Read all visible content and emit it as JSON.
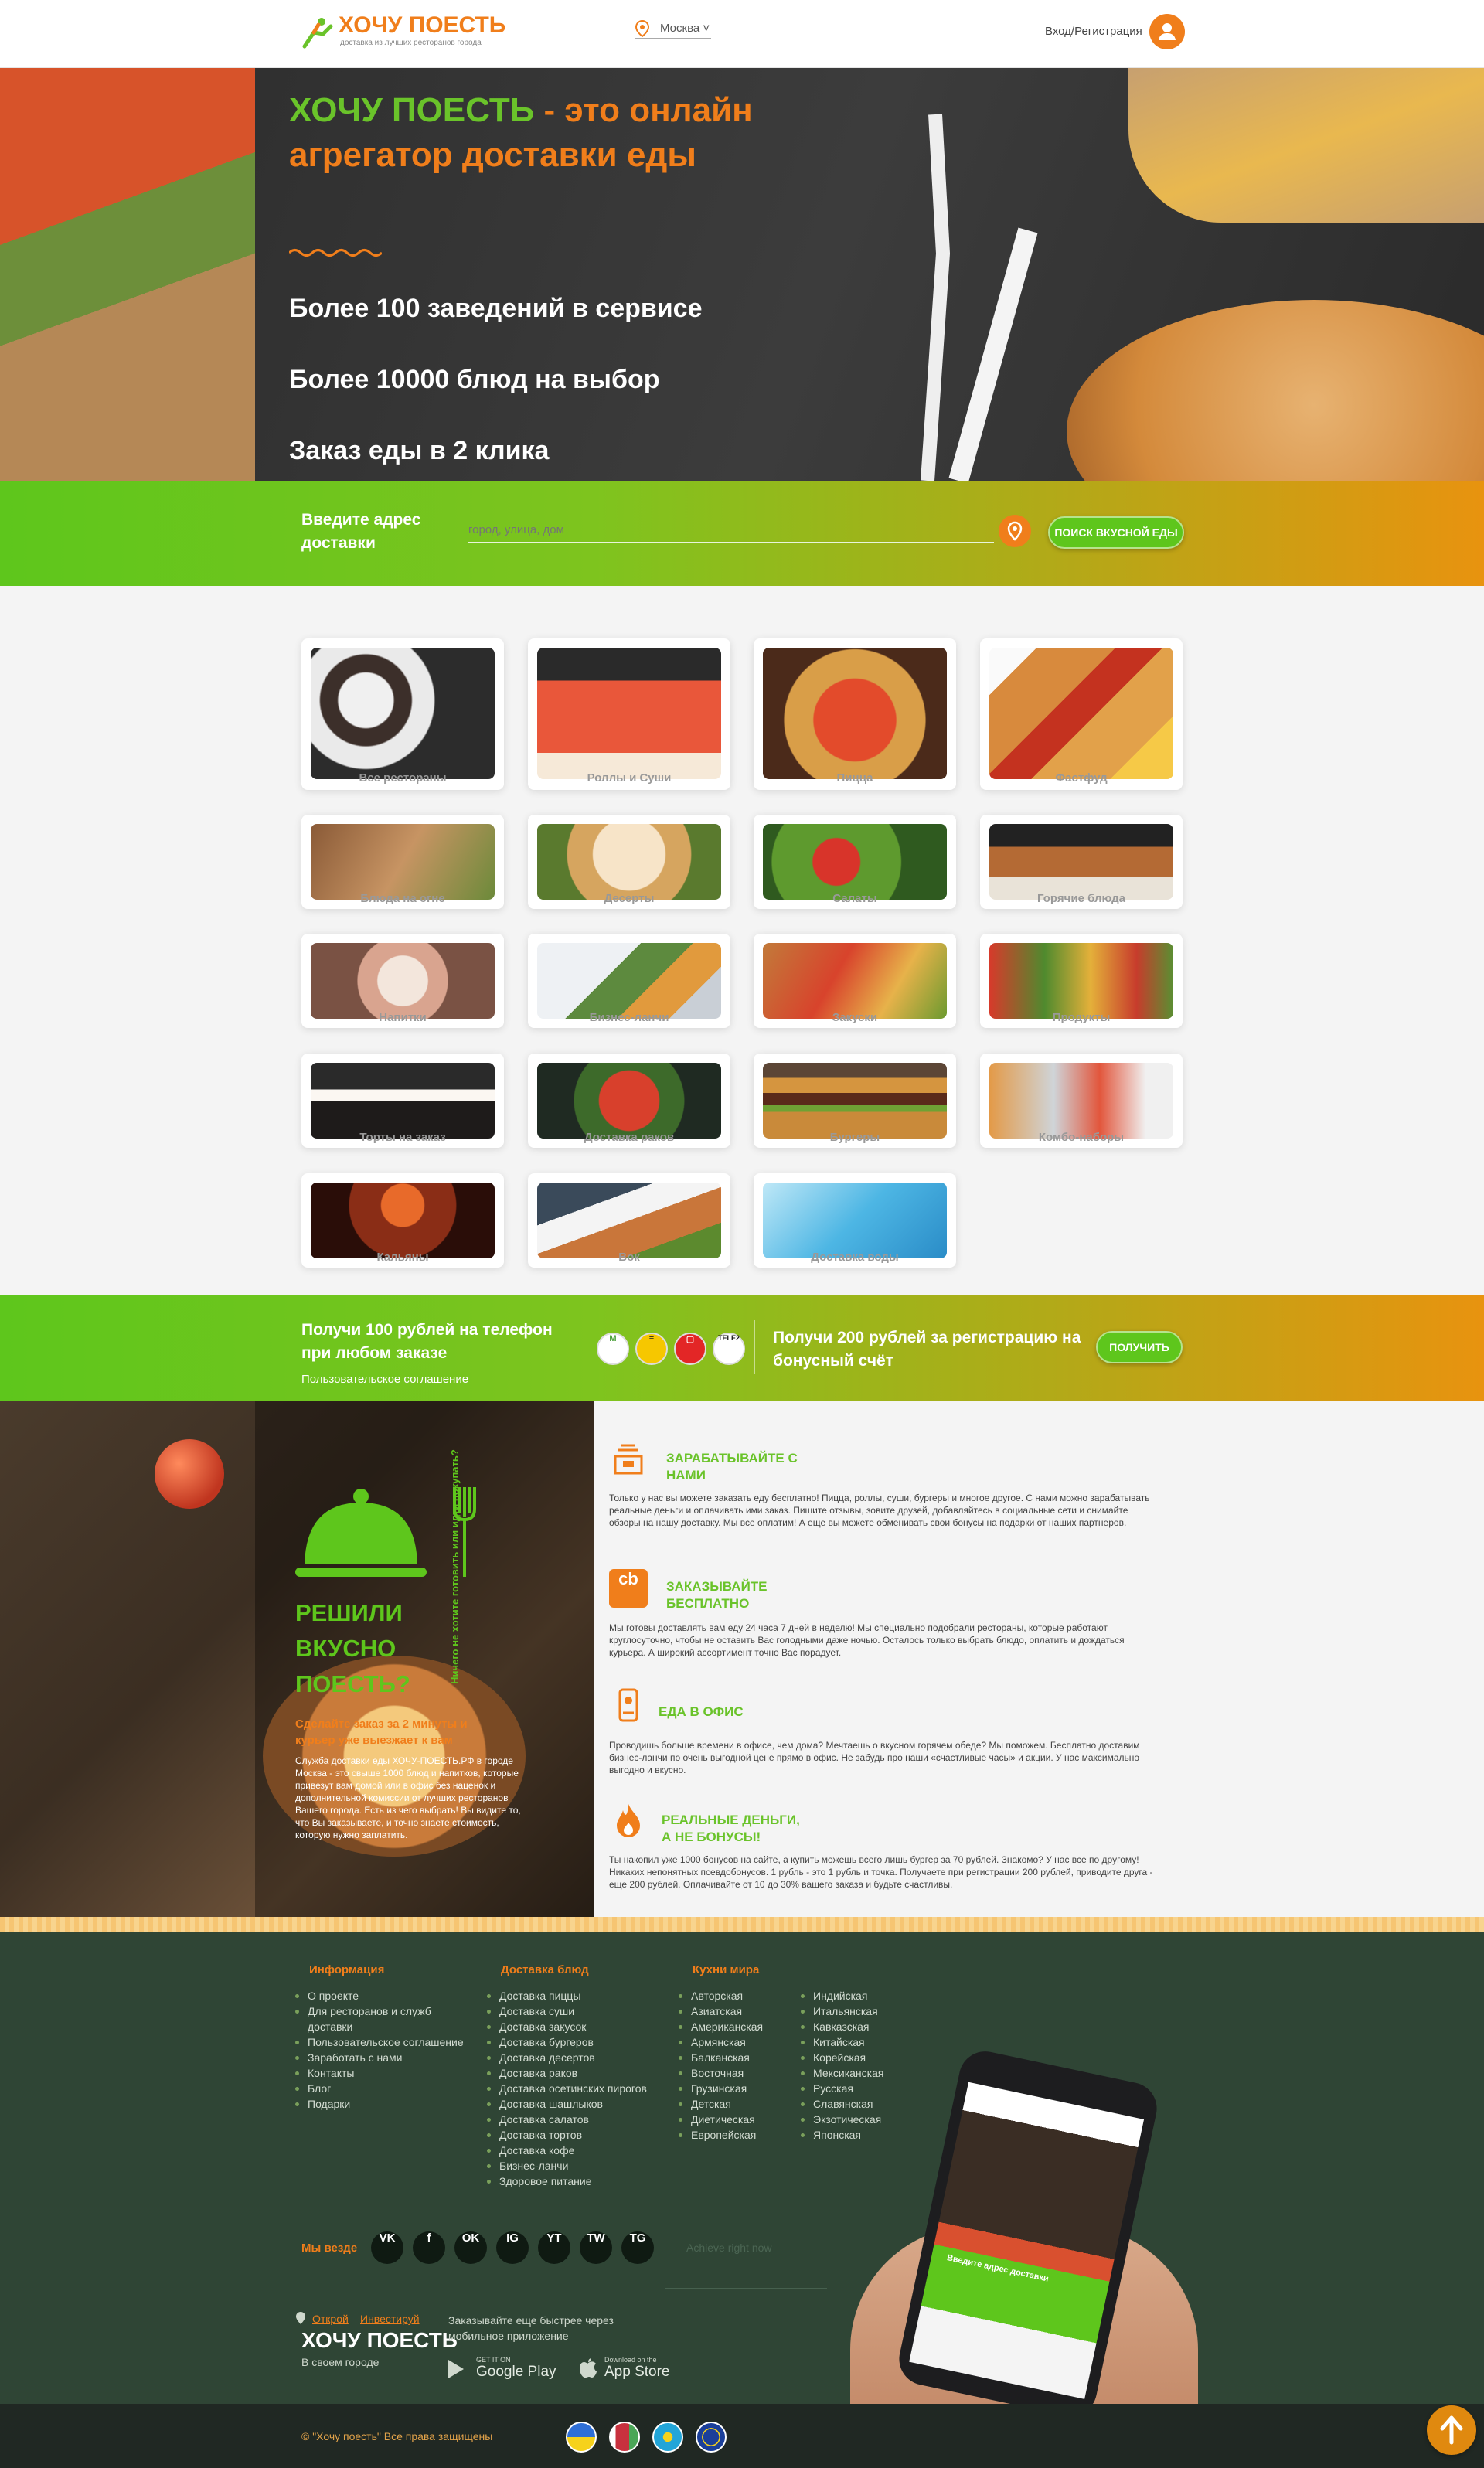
{
  "header": {
    "logo_text": "ХОЧУ ПОЕСТЬ",
    "logo_tagline": "доставка из лучших ресторанов города",
    "city": "Москва",
    "login": "Вход/Регистрация"
  },
  "hero": {
    "title_brand": "ХОЧУ ПОЕСТЬ",
    "title_rest": " - это онлайн агрегатор доставки еды",
    "facts": [
      "Более 100 заведений в сервисе",
      "Более 10000 блюд на выбор",
      "Заказ еды в 2 клика"
    ]
  },
  "address": {
    "label": "Введите адрес доставки",
    "placeholder": "город, улица, дом",
    "button": "ПОИСК ВКУСНОЙ ЕДЫ"
  },
  "categories": [
    "Все рестораны",
    "Роллы и Суши",
    "Пицца",
    "Фастфуд",
    "Блюда на огне",
    "Десерты",
    "Салаты",
    "Горячие блюда",
    "Напитки",
    "Бизнес-ланчи",
    "Закуски",
    "Продукты",
    "Торты на заказ",
    "Доставка раков",
    "Бургеры",
    "Комбо-наборы",
    "Кальяны",
    "Вок",
    "Доставка воды"
  ],
  "promo": {
    "phone_bonus": "Получи 100 рублей на телефон при любом заказе",
    "agreement_link": "Пользовательское соглашение",
    "operators": [
      "Билайн",
      "Мегафон",
      "МТС",
      "TELE2"
    ],
    "reg_bonus": "Получи 200 рублей за регистрацию на бонусный счёт",
    "button": "ПОЛУЧИТЬ"
  },
  "info": {
    "big_title": "РЕШИЛИ ВКУСНО ПОЕСТЬ?",
    "side_text": "Ничего не хотите готовить или идти покупать?",
    "subtitle": "Сделайте заказ за 2 минуты и курьер уже выезжает к вам",
    "body": "Служба доставки еды ХОЧУ-ПОЕСТЬ.РФ в городе Москва - это свыше 1000 блюд и напитков, которые привезут вам домой или в офис без наценок и дополнительной комиссии от лучших ресторанов Вашего города. Есть из чего выбрать! Вы видите то, что Вы заказываете, и точно знаете стоимость, которую нужно заплатить.",
    "features": [
      {
        "title": "ЗАРАБАТЫВАЙТЕ С НАМИ",
        "icon": "cash-icon",
        "text": "Только у нас вы можете заказать еду бесплатно! Пицца, роллы, суши, бургеры и многое другое. С нами можно зарабатывать реальные деньги и оплачивать ими заказ. Пишите отзывы, зовите друзей, добавляйтесь в социальные сети и снимайте обзоры на нашу доставку. Мы все оплатим! А еще вы можете обменивать свои бонусы на подарки от наших партнеров."
      },
      {
        "title": "ЗАКАЗЫВАЙТЕ БЕСПЛАТНО",
        "icon": "cashback-icon",
        "text": "Мы готовы доставлять вам еду 24 часа 7 дней в неделю! Мы специально подобрали рестораны, которые работают круглосуточно, чтобы не оставить Вас голодными даже ночью. Осталось только выбрать блюдо, оплатить и дождаться курьера. А широкий ассортимент точно Вас порадует."
      },
      {
        "title": "ЕДА В ОФИС",
        "icon": "office-icon",
        "text": "Проводишь больше времени в офисе, чем дома? Мечтаешь о вкусном горячем обеде? Мы поможем. Бесплатно доставим бизнес-ланчи по очень выгодной цене прямо в офис. Не забудь про наши «счастливые часы» и акции. У нас максимально выгодно и вкусно."
      },
      {
        "title": "РЕАЛЬНЫЕ ДЕНЬГИ, А НЕ БОНУСЫ!",
        "icon": "fire-icon",
        "text": "Ты накопил уже 1000 бонусов на сайте, а купить можешь всего лишь бургер за 70 рублей. Знакомо? У нас все по другому! Никаких непонятных псевдобонусов. 1 рубль - это 1 рубль и точка. Получаете при регистрации 200 рублей, приводите друга - еще 200 рублей. Оплачивайте от 10 до 30% вашего заказа и будьте счастливы."
      }
    ]
  },
  "footer": {
    "info_title": "Информация",
    "info_links": [
      "О проекте",
      "Для ресторанов и служб доставки",
      "Пользовательское соглашение",
      "Заработать с нами",
      "Контакты",
      "Блог",
      "Подарки"
    ],
    "delivery_title": "Доставка блюд",
    "delivery_links": [
      "Доставка пиццы",
      "Доставка суши",
      "Доставка закусок",
      "Доставка бургеров",
      "Доставка десертов",
      "Доставка раков",
      "Доставка осетинских пирогов",
      "Доставка шашлыков",
      "Доставка салатов",
      "Доставка тортов",
      "Доставка кофе",
      "Бизнес-ланчи",
      "Здоровое питание"
    ],
    "cuisines_title": "Кухни мира",
    "cuisines_col1": [
      "Авторская",
      "Азиатская",
      "Американская",
      "Армянская",
      "Балканская",
      "Восточная",
      "Грузинская",
      "Детская",
      "Диетическая",
      "Европейская"
    ],
    "cuisines_col2": [
      "Индийская",
      "Итальянская",
      "Кавказская",
      "Китайская",
      "Корейская",
      "Мексиканская",
      "Русская",
      "Славянская",
      "Экзотическая",
      "Японская"
    ],
    "social_label": "Мы везде",
    "social": [
      "VK",
      "f",
      "OK",
      "IG",
      "YT",
      "TW",
      "TG"
    ],
    "ghost": "Achieve right now",
    "open_link": "Открой",
    "invest_link": "Инвестируй",
    "brand": "ХОЧУ ПОЕСТЬ",
    "brand_sub": "В своем городе",
    "app_text": "Заказывайте еще быстрее через мобильное приложение",
    "gp_small": "GET IT ON",
    "gp_big": "Google Play",
    "as_small": "Download on the",
    "as_big": "App Store",
    "phone_screen": "Введите адрес доставки",
    "copyright": "© \"Хочу поесть\" Все права защищены"
  },
  "colors": {
    "green": "#5ec61c",
    "orange": "#f07e1b",
    "footer": "#2f4535"
  }
}
